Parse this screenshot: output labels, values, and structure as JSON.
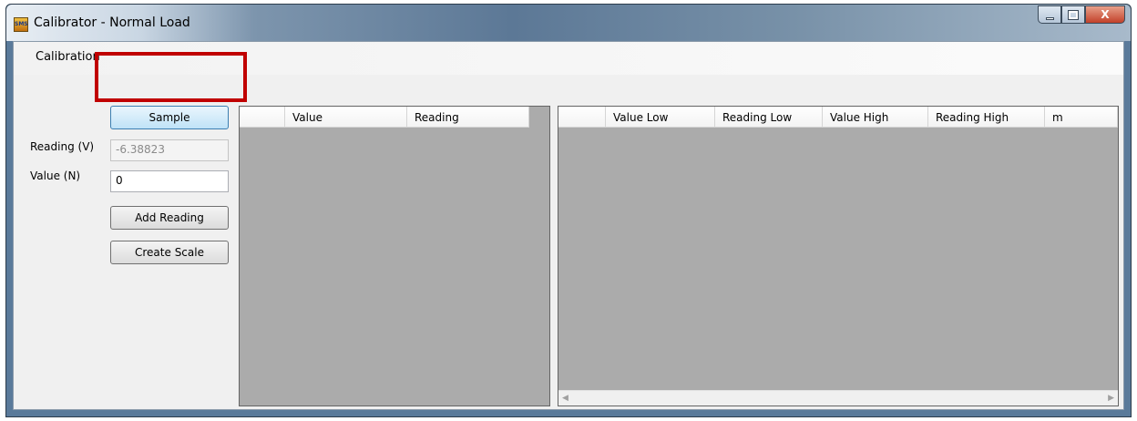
{
  "window": {
    "title": "Calibrator - Normal Load",
    "app_icon_text": "SMS",
    "close_glyph": "X"
  },
  "menu": {
    "items": [
      "Calibration"
    ]
  },
  "controls": {
    "sample_button": "Sample",
    "reading_label": "Reading (V)",
    "reading_value": "-6.38823",
    "value_label": "Value (N)",
    "value_input": "0",
    "add_reading_button": "Add Reading",
    "create_scale_button": "Create Scale"
  },
  "readings_grid": {
    "columns": [
      "",
      "Value",
      "Reading"
    ]
  },
  "scale_grid": {
    "columns": [
      "",
      "Value Low",
      "Reading Low",
      "Value High",
      "Reading High",
      "m"
    ],
    "scroll_left": "◀",
    "scroll_right": "▶"
  },
  "colors": {
    "highlight": "#c00000",
    "grid_background": "#ababab"
  }
}
